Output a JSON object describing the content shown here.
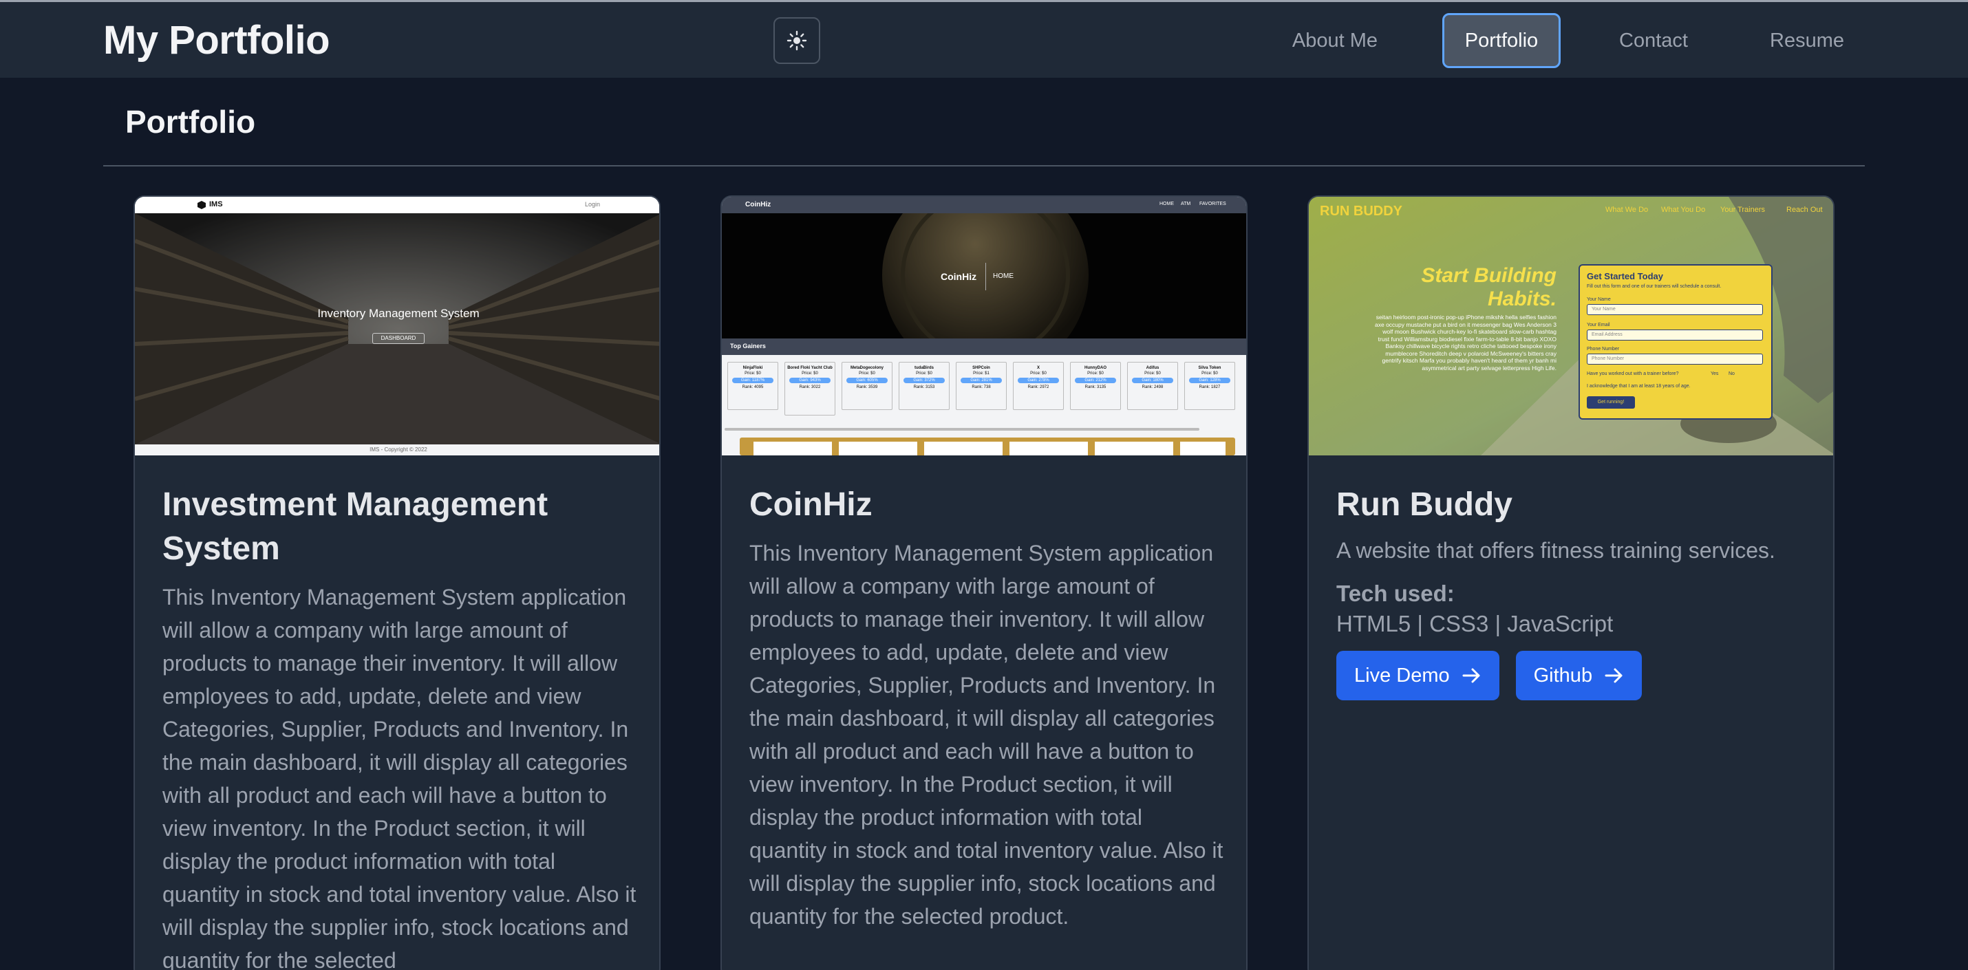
{
  "navbar": {
    "brand": "My Portfolio",
    "theme_toggle_icon": "sun-icon",
    "links": [
      {
        "label": "About Me",
        "active": false
      },
      {
        "label": "Portfolio",
        "active": true
      },
      {
        "label": "Contact",
        "active": false
      },
      {
        "label": "Resume",
        "active": false
      }
    ]
  },
  "page": {
    "heading": "Portfolio"
  },
  "colors": {
    "accent": "#2563eb",
    "background": "#111827",
    "card": "#1f2937",
    "active_border": "#60a5fa"
  },
  "cards": [
    {
      "title": "Investment Management System",
      "description": "This Inventory Management System application will allow a company with large amount of products to manage their inventory. It will allow employees to add, update, delete and view Categories, Supplier, Products and Inventory. In the main dashboard, it will display all categories with all product and each will have a button to view inventory. In the Product section, it will display the product information with total quantity in stock and total inventory value. Also it will display the supplier info, stock locations and quantity for the selected",
      "thumb": {
        "logo": "IMS",
        "login": "Login",
        "hero_title": "Inventory Management System",
        "hero_button": "DASHBOARD",
        "footer": "IMS - Copyright © 2022"
      }
    },
    {
      "title": "CoinHiz",
      "description": "This Inventory Management System application will allow a company with large amount of products to manage their inventory. It will allow employees to add, update, delete and view Categories, Supplier, Products and Inventory. In the main dashboard, it will display all categories with all product and each will have a button to view inventory. In the Product section, it will display the product information with total quantity in stock and total inventory value. Also it will display the supplier info, stock locations and quantity for the selected product.",
      "thumb": {
        "logo": "CoinHiz",
        "nav": [
          "HOME",
          "ATM",
          "FAVORITES"
        ],
        "hero_title": "CoinHiz",
        "hero_link": "HOME",
        "section": "Top Gainers",
        "coins": [
          {
            "name": "NinjaFloki",
            "price": "Price: $0",
            "gain": "Gain: 1187%",
            "rank": "Rank: 4095"
          },
          {
            "name": "Bored Floki Yacht Club",
            "price": "Price: $0",
            "gain": "Gain: 943%",
            "rank": "Rank: 3022"
          },
          {
            "name": "MetaDogecolony",
            "price": "Price: $0",
            "gain": "Gain: 605%",
            "rank": "Rank: 3539"
          },
          {
            "name": "tudaBirds",
            "price": "Price: $0",
            "gain": "Gain: 372%",
            "rank": "Rank: 3153"
          },
          {
            "name": "SHPCoin",
            "price": "Price: $1",
            "gain": "Gain: 281%",
            "rank": "Rank: 738"
          },
          {
            "name": "X",
            "price": "Price: $0",
            "gain": "Gain: 278%",
            "rank": "Rank: 2972"
          },
          {
            "name": "HunnyDAO",
            "price": "Price: $0",
            "gain": "Gain: 212%",
            "rank": "Rank: 3135"
          },
          {
            "name": "Adifus",
            "price": "Price: $0",
            "gain": "Gain: 180%",
            "rank": "Rank: 2498"
          },
          {
            "name": "Silva Token",
            "price": "Price: $0",
            "gain": "Gain: 128%",
            "rank": "Rank: 1827"
          }
        ]
      }
    },
    {
      "title": "Run Buddy",
      "description": "A website that offers fitness training services.",
      "tech_label": "Tech used:",
      "tech_list": "HTML5 |  CSS3 |  JavaScript",
      "buttons": [
        {
          "label": "Live Demo",
          "icon": "arrow-right-icon"
        },
        {
          "label": "Github",
          "icon": "arrow-right-icon"
        }
      ],
      "thumb": {
        "logo": "RUN BUDDY",
        "nav": [
          "What We Do",
          "What You Do",
          "Your Trainers",
          "Reach Out"
        ],
        "hero_title": "Start Building Habits.",
        "hero_text": "seitan heirloom post-ironic pop-up iPhone mikshk hella selfies fashion axe occupy mustache put a bird on it messenger bag Wes Anderson 3 wolf moon Bushwick church-key lo-fi skateboard slow-carb hashtag trust fund Williamsburg biodiesel fixie farm-to-table 8-bit banjo XOXO Banksy chillwave bicycle rights retro cliche tattooed bespoke irony mumblecore Shoreditch deep v polaroid McSweeney's bitters cray gentrify kitsch Marfa you probably haven't heard of them yr banh mi asymmetrical art party selvage letterpress High Life.",
        "form_title": "Get Started Today",
        "form_sub": "Fill out this form and one of our trainers will schedule a consult.",
        "name_label": "Your Name",
        "name_ph": "Your Name",
        "email_label": "Your Email",
        "email_ph": "Email Address",
        "phone_label": "Phone Number",
        "phone_ph": "Phone Number",
        "trainer_q": "Have you worked out with a trainer before?",
        "yes": "Yes",
        "no": "No",
        "ack": "I acknowledge that I am at least 18 years of age.",
        "submit": "Get running!"
      }
    }
  ]
}
